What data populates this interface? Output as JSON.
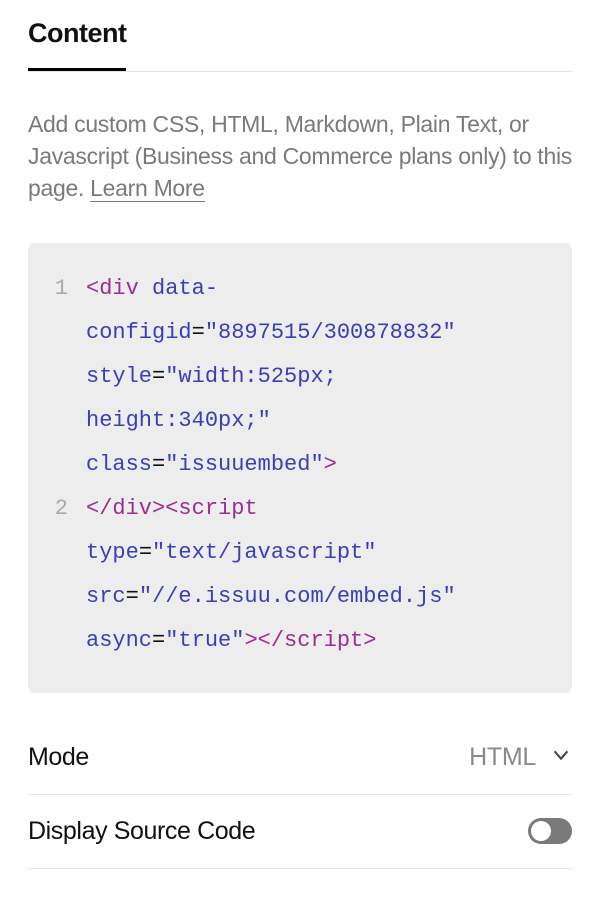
{
  "tabs": {
    "content_label": "Content"
  },
  "description": {
    "text": "Add custom CSS, HTML, Markdown, Plain Text, or Javascript (Business and Commerce plans only) to this page. ",
    "learn_label": "Learn More"
  },
  "code": {
    "line1": {
      "num": "1"
    },
    "line2": {
      "num": "2"
    },
    "tokens": {
      "lt": "<",
      "gt": ">",
      "lts": "</",
      "div": "div",
      "script": "script",
      "data_config_part1": "data-",
      "data_config_part2": "configid",
      "data_config_val": "\"8897515/300878832\"",
      "style_attr": "style",
      "style_val1": "\"width:525px; ",
      "style_val2": "height:340px;\"",
      "class_attr": "class",
      "class_val": "\"issuuembed\"",
      "type_attr": "type",
      "type_val": "\"text/javascript\"",
      "src_attr": "src",
      "src_val": "\"//e.issuu.com/embed.js\"",
      "async_attr": "async",
      "async_val": "\"true\"",
      "eq": "=",
      "sp": " "
    }
  },
  "mode": {
    "label": "Mode",
    "value": "HTML"
  },
  "display_source": {
    "label": "Display Source Code",
    "on": false
  }
}
